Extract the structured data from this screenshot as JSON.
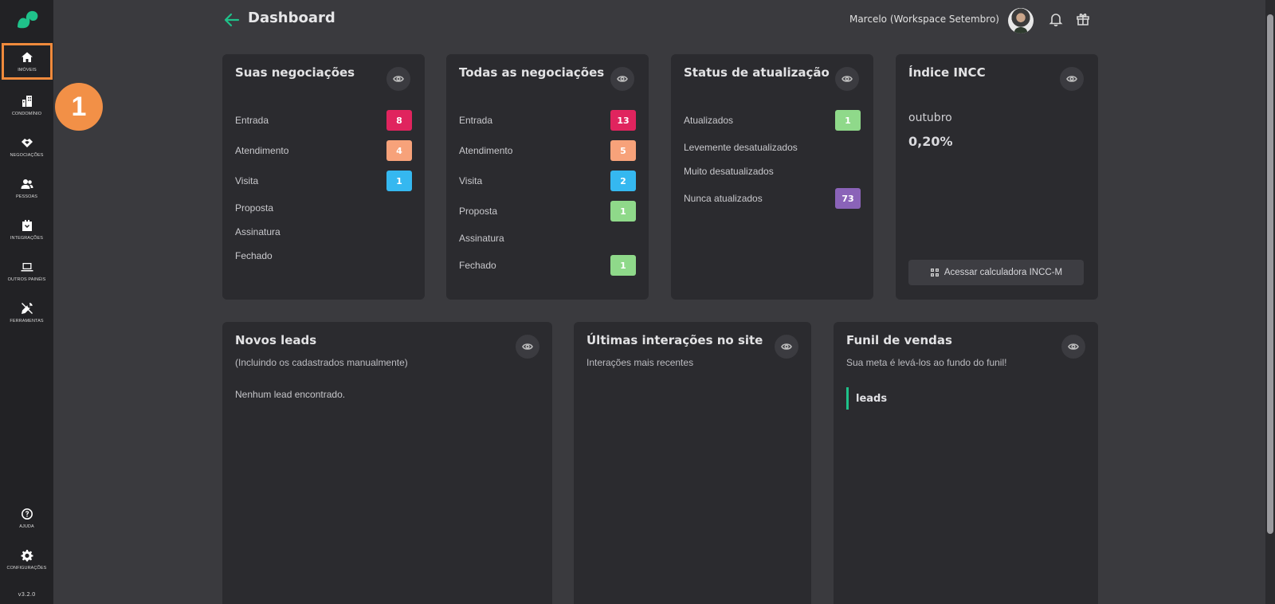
{
  "sidebar": {
    "items": [
      {
        "label": "IMÓVEIS",
        "icon": "home-icon"
      },
      {
        "label": "CONDOMÍNIO",
        "icon": "building-icon"
      },
      {
        "label": "NEGOCIAÇÕES",
        "icon": "handshake-icon"
      },
      {
        "label": "PESSOAS",
        "icon": "users-icon"
      },
      {
        "label": "INTEGRAÇÕES",
        "icon": "plug-icon"
      },
      {
        "label": "OUTROS PAINÉIS",
        "icon": "laptop-icon"
      },
      {
        "label": "FERRAMENTAS",
        "icon": "tools-icon"
      },
      {
        "label": "AJUDA",
        "icon": "help-icon"
      },
      {
        "label": "CONFIGURAÇÕES",
        "icon": "gear-icon"
      }
    ],
    "version": "v3.2.0"
  },
  "step_badge": "1",
  "header": {
    "title": "Dashboard",
    "user": "Marcelo (Workspace Setembro)"
  },
  "cards": {
    "suas": {
      "title": "Suas negociações",
      "rows": [
        {
          "label": "Entrada",
          "count": "8"
        },
        {
          "label": "Atendimento",
          "count": "4"
        },
        {
          "label": "Visita",
          "count": "1"
        },
        {
          "label": "Proposta"
        },
        {
          "label": "Assinatura"
        },
        {
          "label": "Fechado"
        }
      ]
    },
    "todas": {
      "title": "Todas as negociações",
      "rows": [
        {
          "label": "Entrada",
          "count": "13"
        },
        {
          "label": "Atendimento",
          "count": "5"
        },
        {
          "label": "Visita",
          "count": "2"
        },
        {
          "label": "Proposta",
          "count": "1"
        },
        {
          "label": "Assinatura"
        },
        {
          "label": "Fechado",
          "count": "1"
        }
      ]
    },
    "status": {
      "title": "Status de atualização",
      "rows": [
        {
          "label": "Atualizados",
          "count": "1"
        },
        {
          "label": "Levemente desatualizados"
        },
        {
          "label": "Muito desatualizados"
        },
        {
          "label": "Nunca atualizados",
          "count": "73"
        }
      ]
    },
    "incc": {
      "title": "Índice INCC",
      "month": "outubro",
      "value": "0,20%",
      "button": "Acessar calculadora INCC-M"
    },
    "leads": {
      "title": "Novos leads",
      "subtitle": "(Incluindo os cadastrados manualmente)",
      "empty": "Nenhum lead encontrado."
    },
    "interacoes": {
      "title": "Últimas interações no site",
      "subtitle": "Interações mais recentes"
    },
    "funil": {
      "title": "Funil de vendas",
      "subtitle": "Sua meta é levá-los ao fundo do funil!",
      "stage": "leads"
    }
  },
  "colors": {
    "entrada": "#e0245e",
    "atendimento": "#f7a27a",
    "visita": "#35b8f0",
    "proposta": "#8fd98a",
    "fechado": "#8fd98a",
    "atualizados": "#8fd98a",
    "nunca": "#8a63b8",
    "accent": "#1fc28a",
    "highlight": "#f08a3c"
  }
}
